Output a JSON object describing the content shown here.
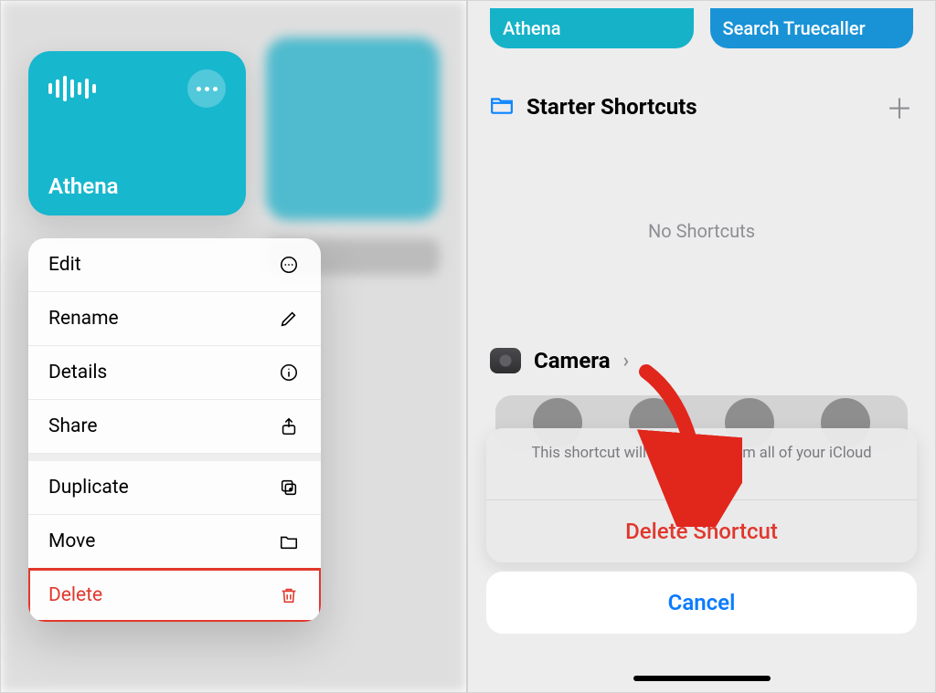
{
  "left": {
    "card": {
      "title": "Athena"
    },
    "menu": {
      "edit": {
        "label": "Edit"
      },
      "rename": {
        "label": "Rename"
      },
      "details": {
        "label": "Details"
      },
      "share": {
        "label": "Share"
      },
      "duplicate": {
        "label": "Duplicate"
      },
      "move": {
        "label": "Move"
      },
      "delete": {
        "label": "Delete"
      }
    }
  },
  "right": {
    "tiles": {
      "athena": "Athena",
      "truecaller": "Search Truecaller"
    },
    "folder": {
      "title": "Starter Shortcuts",
      "empty": "No Shortcuts"
    },
    "camera": {
      "label": "Camera"
    },
    "sheet": {
      "message": "This shortcut will be deleted from all of your iCloud devices.",
      "delete": "Delete Shortcut",
      "cancel": "Cancel"
    }
  }
}
